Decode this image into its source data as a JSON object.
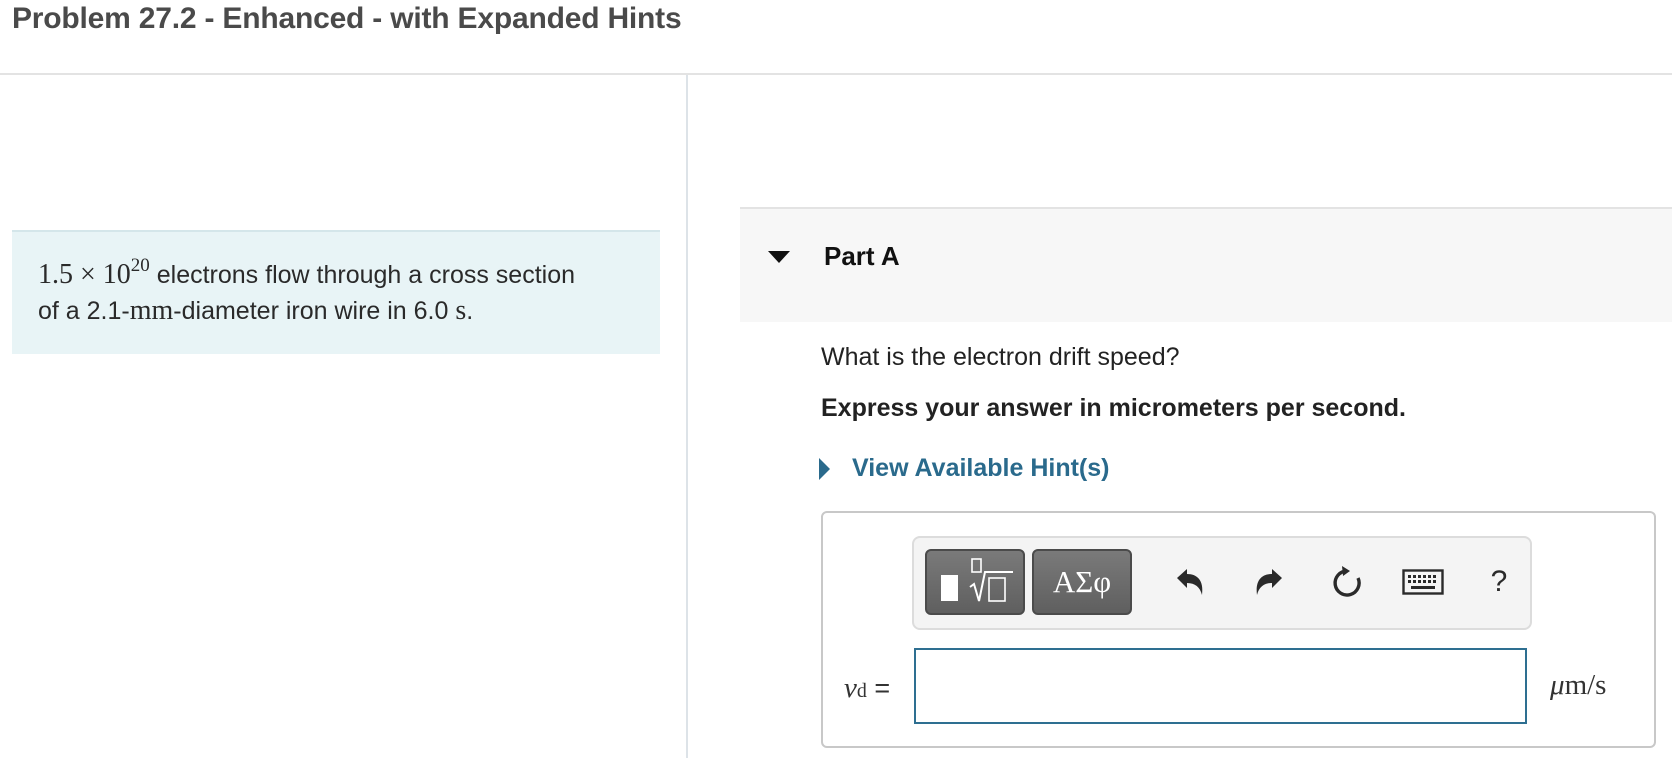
{
  "page": {
    "title": "Problem 27.2 - Enhanced - with Expanded Hints"
  },
  "problem": {
    "coefficient": "1.5 × 10",
    "exponent": "20",
    "text_line1": " electrons flow through a cross section",
    "text_line2_pre": "of a 2.1-",
    "unit_mm": "mm",
    "text_line2_mid": "-diameter iron wire in 6.0 ",
    "unit_s": "s",
    "text_line2_end": "."
  },
  "part": {
    "title": "Part A",
    "question": "What is the electron drift speed?",
    "instruction": "Express your answer in micrometers per second.",
    "hint_label": "View Available Hint(s)"
  },
  "toolbar": {
    "symbols_label": "ΑΣφ",
    "help_label": "?",
    "icons": [
      "templates-icon",
      "undo-icon",
      "redo-icon",
      "reset-icon",
      "keyboard-icon",
      "help-icon"
    ]
  },
  "answer": {
    "variable": "v",
    "subscript": "d",
    "equals": " =",
    "value": "",
    "unit_mu": "μ",
    "unit_rest": "m/s"
  },
  "colors": {
    "link": "#2a6a8c",
    "problem_bg": "#e8f4f6",
    "input_border": "#2e6f91"
  }
}
